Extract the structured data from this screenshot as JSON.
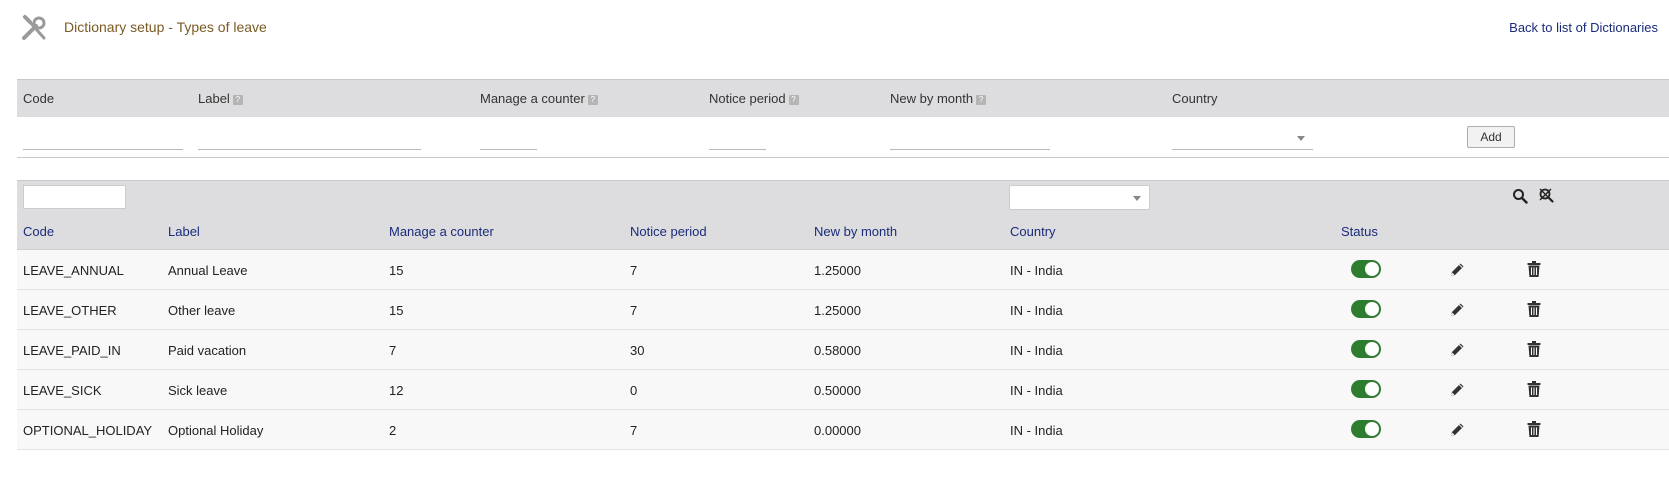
{
  "header": {
    "title": "Dictionary setup - Types of leave",
    "back_link": "Back to list of Dictionaries",
    "icon": "tools-icon"
  },
  "form": {
    "columns": {
      "code": "Code",
      "label": "Label",
      "manage_counter": "Manage a counter",
      "notice_period": "Notice period",
      "new_by_month": "New by month",
      "country": "Country"
    },
    "help_marker": "?",
    "inputs": {
      "code": "",
      "label": "",
      "manage_counter": "",
      "notice_period": "",
      "new_by_month": "",
      "country": ""
    },
    "add_button": "Add"
  },
  "list": {
    "filter_search_icon": "search-icon",
    "filter_clear_icon": "clear-search-icon",
    "headers": {
      "code": "Code",
      "label": "Label",
      "manage_counter": "Manage a counter",
      "notice_period": "Notice period",
      "new_by_month": "New by month",
      "country": "Country",
      "status": "Status"
    },
    "rows": [
      {
        "code": "LEAVE_ANNUAL",
        "label": "Annual Leave",
        "counter": "15",
        "notice": "7",
        "new_by_month": "1.25000",
        "country": "IN - India",
        "status": "on"
      },
      {
        "code": "LEAVE_OTHER",
        "label": "Other leave",
        "counter": "15",
        "notice": "7",
        "new_by_month": "1.25000",
        "country": "IN - India",
        "status": "on"
      },
      {
        "code": "LEAVE_PAID_IN",
        "label": "Paid vacation",
        "counter": "7",
        "notice": "30",
        "new_by_month": "0.58000",
        "country": "IN - India",
        "status": "on"
      },
      {
        "code": "LEAVE_SICK",
        "label": "Sick leave",
        "counter": "12",
        "notice": "0",
        "new_by_month": "0.50000",
        "country": "IN - India",
        "status": "on"
      },
      {
        "code": "OPTIONAL_HOLIDAY",
        "label": "Optional Holiday",
        "counter": "2",
        "notice": "7",
        "new_by_month": "0.00000",
        "country": "IN - India",
        "status": "on"
      }
    ]
  },
  "colors": {
    "title": "#7a5a23",
    "link": "#1a2b7a",
    "header_bg": "#dddde0",
    "toggle_on": "#2e7d2e"
  }
}
